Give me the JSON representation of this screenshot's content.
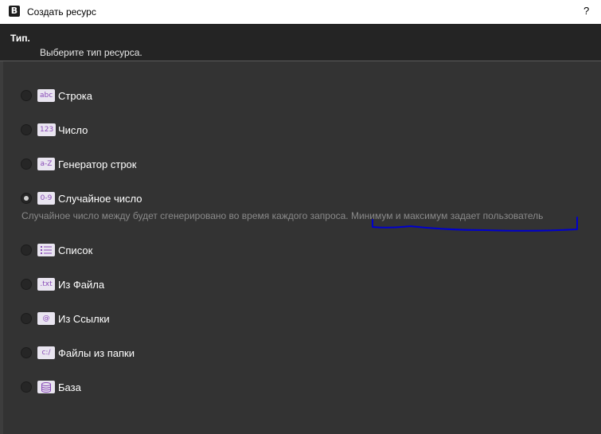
{
  "window": {
    "title": "Создать ресурс",
    "help": "?",
    "app_icon": "B"
  },
  "header": {
    "title": "Тип.",
    "subtitle": "Выберите тип ресурса."
  },
  "options": [
    {
      "badge": "abc",
      "label": "Строка",
      "selected": false
    },
    {
      "badge": "123",
      "label": "Число",
      "selected": false
    },
    {
      "badge": "a-Z",
      "label": "Генератор строк",
      "selected": false
    },
    {
      "badge": "0-9",
      "label": "Случайное число",
      "selected": true
    },
    {
      "badge": "list-icon",
      "label": "Список",
      "selected": false
    },
    {
      "badge": ".txt",
      "label": "Из Файла",
      "selected": false
    },
    {
      "badge": "@",
      "label": "Из Ссылки",
      "selected": false
    },
    {
      "badge": "c:/",
      "label": "Файлы из папки",
      "selected": false
    },
    {
      "badge": "database-icon",
      "label": "База",
      "selected": false
    }
  ],
  "selected_description": "Случайное число между будет сгенерировано во время каждого запроса. Минимум и максимум задает пользователь",
  "colors": {
    "background": "#333333",
    "header": "#242424",
    "badge_bg": "#e9e5f0",
    "badge_text": "#8a4cb8",
    "annotation": "#0000cc"
  }
}
